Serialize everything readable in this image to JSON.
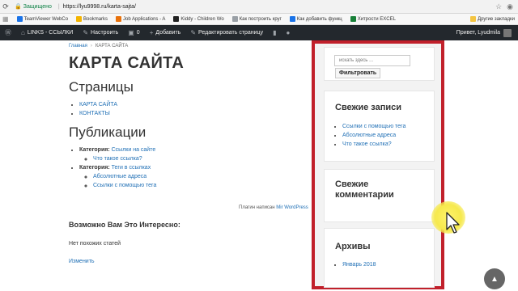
{
  "browser": {
    "secure_label": "Защищено",
    "url_domain": "https://lyu9998.ru",
    "url_path": "/karta-sajta/",
    "bookmarks": [
      {
        "label": "TeamViewer WebCo",
        "color": "#1a73e8"
      },
      {
        "label": "Bookmarks",
        "color": "#f4b400"
      },
      {
        "label": "Job Applications - A",
        "color": "#e8710a"
      },
      {
        "label": "Kiddy - Children Wo",
        "color": "#222222"
      },
      {
        "label": "Как построить круг",
        "color": "#9aa0a6"
      },
      {
        "label": "Как добавить функц",
        "color": "#1a73e8"
      },
      {
        "label": "Хитрости EXCEL",
        "color": "#188038"
      }
    ],
    "bookmarks_other": "Другие закладки"
  },
  "wpbar": {
    "site": "LINKS - ССЫЛКИ",
    "customize": "Настроить",
    "comments_count": "0",
    "add": "Добавить",
    "edit_page": "Редактировать страницу",
    "greeting": "Привет, Lyudmila"
  },
  "page": {
    "breadcrumb_home": "Главная",
    "breadcrumb_current": "КАРТА САЙТА",
    "title": "КАРТА САЙТА",
    "pages_heading": "Страницы",
    "pages": [
      "КАРТА САЙТА",
      "КОНТАКТЫ"
    ],
    "posts_heading": "Публикации",
    "categories": [
      {
        "prefix": "Категория:",
        "name": "Ссылки на сайте",
        "posts": [
          "Что такое ссылка?"
        ]
      },
      {
        "prefix": "Категория:",
        "name": "Теги в ссылках",
        "posts": [
          "Абсолютные адреса",
          "Ссылки с помощью тега"
        ]
      }
    ],
    "plugin_text": "Плагин написан",
    "plugin_link": "Mir WordPress",
    "related_heading": "Возможно Вам Это Интересно:",
    "no_related": "Нет похожих статей",
    "edit_link": "Изменить"
  },
  "sidebar": {
    "search_placeholder": "искать здесь ...",
    "search_button": "Фильтровать",
    "recent_title": "Свежие записи",
    "recent_posts": [
      "Ссылки с помощью тега",
      "Абсолютные адреса",
      "Что такое ссылка?"
    ],
    "comments_title": "Свежие комментарии",
    "archive_title": "Архивы",
    "archives": [
      "Январь 2018"
    ]
  },
  "colors": {
    "link": "#1f6fb5",
    "highlight_border": "#c1202b",
    "admin_bar": "#23282d"
  }
}
